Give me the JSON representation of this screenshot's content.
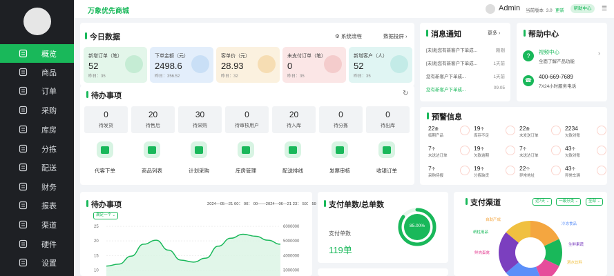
{
  "sidebar": {
    "items": [
      {
        "label": "概览",
        "icon": "overview-icon",
        "active": true
      },
      {
        "label": "商品",
        "icon": "goods-icon"
      },
      {
        "label": "订单",
        "icon": "order-icon"
      },
      {
        "label": "采购",
        "icon": "purchase-icon"
      },
      {
        "label": "库房",
        "icon": "warehouse-icon"
      },
      {
        "label": "分拣",
        "icon": "sorting-icon"
      },
      {
        "label": "配送",
        "icon": "delivery-icon"
      },
      {
        "label": "财务",
        "icon": "finance-icon"
      },
      {
        "label": "报表",
        "icon": "report-icon"
      },
      {
        "label": "渠道",
        "icon": "channel-icon"
      },
      {
        "label": "硬件",
        "icon": "hardware-icon"
      },
      {
        "label": "设置",
        "icon": "settings-icon"
      }
    ]
  },
  "topbar": {
    "brand": "万象优先商城",
    "user": "Admin",
    "version_label": "当前版本",
    "version": "3.0",
    "update": "更新",
    "help": "帮助中心"
  },
  "today": {
    "title": "今日数据",
    "flow": "系统流程",
    "screen": "数据投屏",
    "stats": [
      {
        "title": "新增订单（笔）",
        "value": "52",
        "yesterday": "昨日：35",
        "bg": "#e3f6ea",
        "deco": "#c5ecd4"
      },
      {
        "title": "下单金额（元）",
        "value": "2498.6",
        "yesterday": "昨日：356.52",
        "bg": "#e3eefb",
        "deco": "#c9dff6"
      },
      {
        "title": "客单价（元）",
        "value": "28.93",
        "yesterday": "昨日：32",
        "bg": "#fbf1df",
        "deco": "#f6ddb3"
      },
      {
        "title": "未支付订单（笔）",
        "value": "0",
        "yesterday": "昨日：35",
        "bg": "#fbe6e6",
        "deco": "#f4cccc"
      },
      {
        "title": "新增客户（人）",
        "value": "52",
        "yesterday": "昨日：35",
        "bg": "#e0f5f3",
        "deco": "#c3ebe7"
      }
    ]
  },
  "todo": {
    "title": "待办事项",
    "items": [
      {
        "n": "0",
        "l": "待发货"
      },
      {
        "n": "20",
        "l": "待售后"
      },
      {
        "n": "30",
        "l": "待采购"
      },
      {
        "n": "0",
        "l": "待审核用户"
      },
      {
        "n": "20",
        "l": "待入库"
      },
      {
        "n": "0",
        "l": "待分拣"
      },
      {
        "n": "0",
        "l": "待出库"
      }
    ],
    "actions": [
      "代客下单",
      "商品列表",
      "计划采购",
      "库房管理",
      "配送排线",
      "发票审核",
      "收银订单"
    ]
  },
  "messages": {
    "title": "消息通知",
    "more": "更多",
    "items": [
      {
        "t": "[未读]您有新客户下单成...",
        "time": "刚刚",
        "color": "#555"
      },
      {
        "t": "[未读]您有新客户下单成...",
        "time": "1天前",
        "color": "#555"
      },
      {
        "t": "您有新客户下单成...",
        "time": "1天前",
        "color": "#555"
      },
      {
        "t": "您有新客户下单成...",
        "time": "09.05",
        "color": "#19b85a"
      }
    ]
  },
  "help": {
    "title": "帮助中心",
    "video": "视频中心",
    "video_sub": "全面了解产品功能",
    "phone": "400-669-7689",
    "phone_sub": "7X24小时服务电话"
  },
  "warnings": {
    "title": "预警信息",
    "items": [
      {
        "n": "22",
        "u": "条",
        "l": "临期产品"
      },
      {
        "n": "19",
        "u": "个",
        "l": "库存不足"
      },
      {
        "n": "22",
        "u": "条",
        "l": "未发送订单"
      },
      {
        "n": "2234",
        "u": "",
        "l": "欠款对账"
      },
      {
        "n": "7",
        "u": "个",
        "l": "未送达订单"
      },
      {
        "n": "19",
        "u": "个",
        "l": "欠款逾期"
      },
      {
        "n": "7",
        "u": "个",
        "l": "未送达订单"
      },
      {
        "n": "43",
        "u": "个",
        "l": "欠款对账"
      },
      {
        "n": "7",
        "u": "个",
        "l": "采购待报"
      },
      {
        "n": "19",
        "u": "个",
        "l": "分拣缺货"
      },
      {
        "n": "22",
        "u": "个",
        "l": "异常地址"
      },
      {
        "n": "43",
        "u": "个",
        "l": "异常车辆"
      }
    ]
  },
  "todo_chart": {
    "title": "待办事项",
    "range": "2024—05—21 00： 00： 00——2024—06—21 23： 59： 59",
    "select": "满足一个"
  },
  "pay": {
    "title": "支付单数/总单数",
    "label": "支付单数",
    "value": "119单",
    "percent": "85.00%",
    "percent_value": 85
  },
  "channel": {
    "title": "支付渠道",
    "filters": [
      "近7天",
      "一级分类",
      "全部"
    ]
  },
  "chart_data": [
    {
      "type": "area",
      "title": "待办事项",
      "y_left_ticks": [
        "25",
        "20",
        "15",
        "10"
      ],
      "y_right_ticks": [
        "6000000",
        "5000000",
        "4000000",
        "3000000"
      ],
      "ylim": [
        0,
        25
      ],
      "series": [
        {
          "color": "#19b85a",
          "values": [
            5,
            6,
            10,
            16,
            18,
            13,
            8,
            7,
            9,
            15,
            19,
            21,
            20,
            18,
            16
          ]
        }
      ]
    },
    {
      "type": "pie",
      "categories": [
        "自助产成",
        "纸柱用品",
        "鲜肉蛋禽",
        "冷冻食品",
        "生鲜果蔬",
        "酒水饮料"
      ],
      "values": [
        18,
        14,
        12,
        20,
        22,
        14
      ],
      "colors": [
        "#f4a640",
        "#19b85a",
        "#e64d9b",
        "#5b8ff9",
        "#7b3fbf",
        "#f0c040"
      ]
    }
  ]
}
